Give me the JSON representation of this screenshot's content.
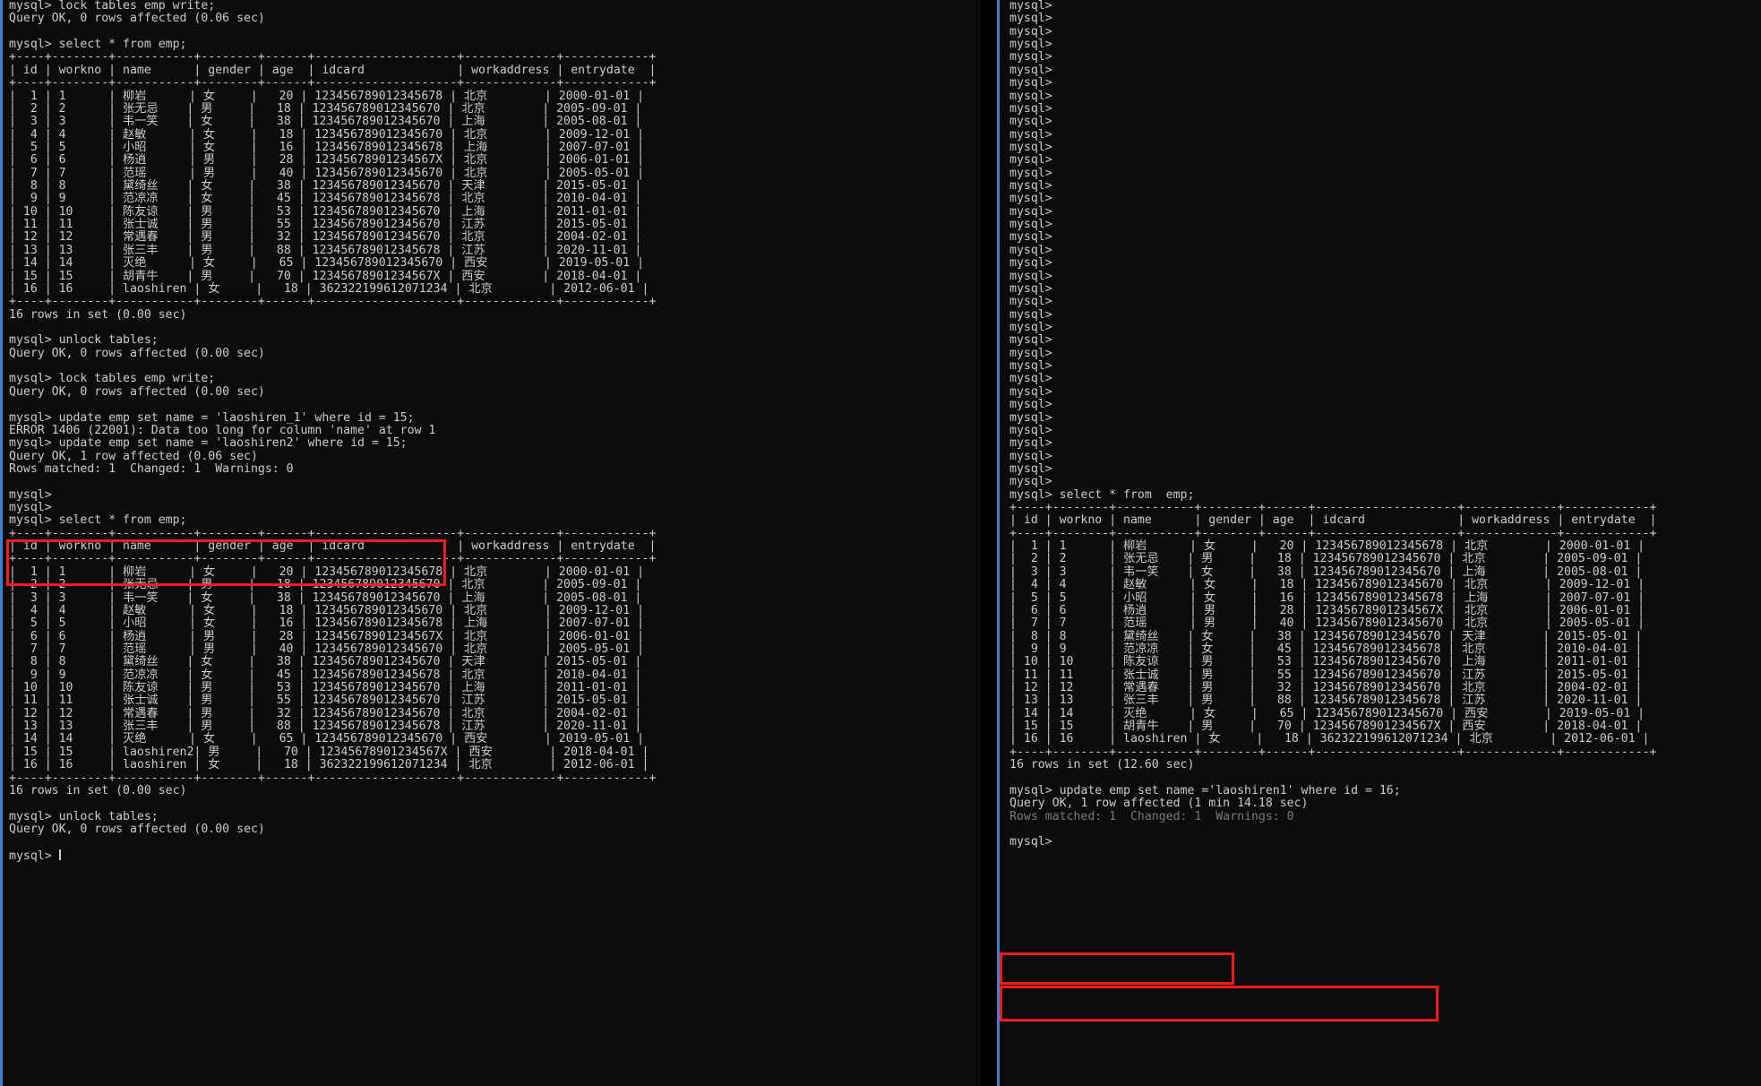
{
  "window": {
    "background": "#000000",
    "pane_background": "#0c0c0c",
    "text_color": "#cccccc",
    "accent_border": "#3f7fcf",
    "highlight_color": "#ff1a1a",
    "prompt": "mysql>"
  },
  "table_schema": {
    "columns": [
      "id",
      "workno",
      "name",
      "gender",
      "age",
      "idcard",
      "workaddress",
      "entrydate"
    ],
    "separator_left": "+----+--------+-----------+--------+------+--------------------+-------------+------------+",
    "header_left": "| id | workno | name      | gender | age  | idcard             | workaddress | entrydate  |",
    "separator_right": "+----+--------+-----------+--------+------+--------------------+-------------+------------+",
    "header_right": "| id | workno | name      | gender | age  | idcard             | workaddress | entrydate  |"
  },
  "left_pane": {
    "name": "left-terminal-pane",
    "lines": [
      {
        "id": "l0",
        "text": "mysql> lock tables emp write;"
      },
      {
        "id": "l1",
        "text": "Query OK, 0 rows affected (0.06 sec)"
      },
      {
        "id": "l2",
        "text": ""
      },
      {
        "id": "l3",
        "text": "mysql> select * from emp;"
      },
      {
        "id": "l4",
        "text": "+----+--------+-----------+--------+------+--------------------+-------------+------------+"
      },
      {
        "id": "l5",
        "text": "| id | workno | name      | gender | age  | idcard             | workaddress | entrydate  |"
      },
      {
        "id": "l6",
        "text": "+----+--------+-----------+--------+------+--------------------+-------------+------------+"
      },
      {
        "id": "l7",
        "text": "|  1 | 1      | 柳岩      | 女     |   20 | 123456789012345678 | 北京        | 2000-01-01 |"
      },
      {
        "id": "l8",
        "text": "|  2 | 2      | 张无忌    | 男     |   18 | 123456789012345670 | 北京        | 2005-09-01 |"
      },
      {
        "id": "l9",
        "text": "|  3 | 3      | 韦一笑    | 女     |   38 | 123456789012345670 | 上海        | 2005-08-01 |"
      },
      {
        "id": "l10",
        "text": "|  4 | 4      | 赵敏      | 女     |   18 | 123456789012345670 | 北京        | 2009-12-01 |"
      },
      {
        "id": "l11",
        "text": "|  5 | 5      | 小昭      | 女     |   16 | 123456789012345678 | 上海        | 2007-07-01 |"
      },
      {
        "id": "l12",
        "text": "|  6 | 6      | 杨逍      | 男     |   28 | 12345678901234567X | 北京        | 2006-01-01 |"
      },
      {
        "id": "l13",
        "text": "|  7 | 7      | 范瑶      | 男     |   40 | 123456789012345670 | 北京        | 2005-05-01 |"
      },
      {
        "id": "l14",
        "text": "|  8 | 8      | 黛绮丝    | 女     |   38 | 123456789012345670 | 天津        | 2015-05-01 |"
      },
      {
        "id": "l15",
        "text": "|  9 | 9      | 范凉凉    | 女     |   45 | 123456789012345678 | 北京        | 2010-04-01 |"
      },
      {
        "id": "l16",
        "text": "| 10 | 10     | 陈友谅    | 男     |   53 | 123456789012345670 | 上海        | 2011-01-01 |"
      },
      {
        "id": "l17",
        "text": "| 11 | 11     | 张士诚    | 男     |   55 | 123456789012345670 | 江苏        | 2015-05-01 |"
      },
      {
        "id": "l18",
        "text": "| 12 | 12     | 常遇春    | 男     |   32 | 123456789012345670 | 北京        | 2004-02-01 |"
      },
      {
        "id": "l19",
        "text": "| 13 | 13     | 张三丰    | 男     |   88 | 123456789012345678 | 江苏        | 2020-11-01 |"
      },
      {
        "id": "l20",
        "text": "| 14 | 14     | 灭绝      | 女     |   65 | 123456789012345670 | 西安        | 2019-05-01 |"
      },
      {
        "id": "l21",
        "text": "| 15 | 15     | 胡青牛    | 男     |   70 | 12345678901234567X | 西安        | 2018-04-01 |"
      },
      {
        "id": "l22",
        "text": "| 16 | 16     | laoshiren | 女     |   18 | 362322199612071234 | 北京        | 2012-06-01 |"
      },
      {
        "id": "l23",
        "text": "+----+--------+-----------+--------+------+--------------------+-------------+------------+"
      },
      {
        "id": "l24",
        "text": "16 rows in set (0.00 sec)"
      },
      {
        "id": "l25",
        "text": ""
      },
      {
        "id": "l26",
        "text": "mysql> unlock tables;"
      },
      {
        "id": "l27",
        "text": "Query OK, 0 rows affected (0.00 sec)"
      },
      {
        "id": "l28",
        "text": ""
      },
      {
        "id": "l29",
        "text": "mysql> lock tables emp write;"
      },
      {
        "id": "l30",
        "text": "Query OK, 0 rows affected (0.00 sec)"
      },
      {
        "id": "l31",
        "text": ""
      },
      {
        "id": "l32",
        "text": "mysql> update emp set name = 'laoshiren_1' where id = 15;"
      },
      {
        "id": "l33",
        "text": "ERROR 1406 (22001): Data too long for column 'name' at row 1"
      },
      {
        "id": "l34",
        "text": "mysql> update emp set name = 'laoshiren2' where id = 15;"
      },
      {
        "id": "l35",
        "text": "Query OK, 1 row affected (0.06 sec)"
      },
      {
        "id": "l36",
        "text": "Rows matched: 1  Changed: 1  Warnings: 0"
      },
      {
        "id": "l37",
        "text": ""
      },
      {
        "id": "l38",
        "text": "mysql>"
      },
      {
        "id": "l39",
        "text": "mysql>"
      },
      {
        "id": "l40",
        "text": "mysql> select * from emp;"
      },
      {
        "id": "l41",
        "text": "+----+--------+-----------+--------+------+--------------------+-------------+------------+"
      },
      {
        "id": "l42",
        "text": "| id | workno | name      | gender | age  | idcard             | workaddress | entrydate  |"
      },
      {
        "id": "l43",
        "text": "+----+--------+-----------+--------+------+--------------------+-------------+------------+"
      },
      {
        "id": "l44",
        "text": "|  1 | 1      | 柳岩      | 女     |   20 | 123456789012345678 | 北京        | 2000-01-01 |"
      },
      {
        "id": "l45",
        "text": "|  2 | 2      | 张无忌    | 男     |   18 | 123456789012345670 | 北京        | 2005-09-01 |"
      },
      {
        "id": "l46",
        "text": "|  3 | 3      | 韦一笑    | 女     |   38 | 123456789012345670 | 上海        | 2005-08-01 |"
      },
      {
        "id": "l47",
        "text": "|  4 | 4      | 赵敏      | 女     |   18 | 123456789012345670 | 北京        | 2009-12-01 |"
      },
      {
        "id": "l48",
        "text": "|  5 | 5      | 小昭      | 女     |   16 | 123456789012345678 | 上海        | 2007-07-01 |"
      },
      {
        "id": "l49",
        "text": "|  6 | 6      | 杨逍      | 男     |   28 | 12345678901234567X | 北京        | 2006-01-01 |"
      },
      {
        "id": "l50",
        "text": "|  7 | 7      | 范瑶      | 男     |   40 | 123456789012345670 | 北京        | 2005-05-01 |"
      },
      {
        "id": "l51",
        "text": "|  8 | 8      | 黛绮丝    | 女     |   38 | 123456789012345670 | 天津        | 2015-05-01 |"
      },
      {
        "id": "l52",
        "text": "|  9 | 9      | 范凉凉    | 女     |   45 | 123456789012345678 | 北京        | 2010-04-01 |"
      },
      {
        "id": "l53",
        "text": "| 10 | 10     | 陈友谅    | 男     |   53 | 123456789012345670 | 上海        | 2011-01-01 |"
      },
      {
        "id": "l54",
        "text": "| 11 | 11     | 张士诚    | 男     |   55 | 123456789012345670 | 江苏        | 2015-05-01 |"
      },
      {
        "id": "l55",
        "text": "| 12 | 12     | 常遇春    | 男     |   32 | 123456789012345670 | 北京        | 2004-02-01 |"
      },
      {
        "id": "l56",
        "text": "| 13 | 13     | 张三丰    | 男     |   88 | 123456789012345678 | 江苏        | 2020-11-01 |"
      },
      {
        "id": "l57",
        "text": "| 14 | 14     | 灭绝      | 女     |   65 | 123456789012345670 | 西安        | 2019-05-01 |"
      },
      {
        "id": "l58",
        "text": "| 15 | 15     | laoshiren2| 男     |   70 | 12345678901234567X | 西安        | 2018-04-01 |"
      },
      {
        "id": "l59",
        "text": "| 16 | 16     | laoshiren | 女     |   18 | 362322199612071234 | 北京        | 2012-06-01 |"
      },
      {
        "id": "l60",
        "text": "+----+--------+-----------+--------+------+--------------------+-------------+------------+"
      },
      {
        "id": "l61",
        "text": "16 rows in set (0.00 sec)"
      },
      {
        "id": "l62",
        "text": ""
      },
      {
        "id": "l63",
        "text": "mysql> unlock tables;"
      },
      {
        "id": "l64",
        "text": "Query OK, 0 rows affected (0.00 sec)"
      },
      {
        "id": "l65",
        "text": ""
      },
      {
        "id": "l66",
        "text": "mysql> ",
        "cursor": true
      }
    ],
    "highlight_box": {
      "name": "left-update-highlight",
      "lines": [
        "mysql> update emp set name = 'laoshiren2' where id = 15;",
        "Query OK, 1 row affected (0.06 sec)",
        "Rows matched: 1  Changed: 1  Warnings: 0"
      ]
    }
  },
  "right_pane": {
    "name": "right-terminal-pane",
    "idle_prompt_count": 38,
    "lines": [
      {
        "id": "r0",
        "text": "mysql> select * from  emp;"
      },
      {
        "id": "r1",
        "text": "+----+--------+-----------+--------+------+--------------------+-------------+------------+"
      },
      {
        "id": "r2",
        "text": "| id | workno | name      | gender | age  | idcard             | workaddress | entrydate  |"
      },
      {
        "id": "r3",
        "text": "+----+--------+-----------+--------+------+--------------------+-------------+------------+"
      },
      {
        "id": "r4",
        "text": "|  1 | 1      | 柳岩      | 女     |   20 | 123456789012345678 | 北京        | 2000-01-01 |"
      },
      {
        "id": "r5",
        "text": "|  2 | 2      | 张无忌    | 男     |   18 | 123456789012345670 | 北京        | 2005-09-01 |"
      },
      {
        "id": "r6",
        "text": "|  3 | 3      | 韦一笑    | 女     |   38 | 123456789012345670 | 上海        | 2005-08-01 |"
      },
      {
        "id": "r7",
        "text": "|  4 | 4      | 赵敏      | 女     |   18 | 123456789012345670 | 北京        | 2009-12-01 |"
      },
      {
        "id": "r8",
        "text": "|  5 | 5      | 小昭      | 女     |   16 | 123456789012345678 | 上海        | 2007-07-01 |"
      },
      {
        "id": "r9",
        "text": "|  6 | 6      | 杨逍      | 男     |   28 | 12345678901234567X | 北京        | 2006-01-01 |"
      },
      {
        "id": "r10",
        "text": "|  7 | 7      | 范瑶      | 男     |   40 | 123456789012345670 | 北京        | 2005-05-01 |"
      },
      {
        "id": "r11",
        "text": "|  8 | 8      | 黛绮丝    | 女     |   38 | 123456789012345670 | 天津        | 2015-05-01 |"
      },
      {
        "id": "r12",
        "text": "|  9 | 9      | 范凉凉    | 女     |   45 | 123456789012345678 | 北京        | 2010-04-01 |"
      },
      {
        "id": "r13",
        "text": "| 10 | 10     | 陈友谅    | 男     |   53 | 123456789012345670 | 上海        | 2011-01-01 |"
      },
      {
        "id": "r14",
        "text": "| 11 | 11     | 张士诚    | 男     |   55 | 123456789012345670 | 江苏        | 2015-05-01 |"
      },
      {
        "id": "r15",
        "text": "| 12 | 12     | 常遇春    | 男     |   32 | 123456789012345670 | 北京        | 2004-02-01 |"
      },
      {
        "id": "r16",
        "text": "| 13 | 13     | 张三丰    | 男     |   88 | 123456789012345678 | 江苏        | 2020-11-01 |"
      },
      {
        "id": "r17",
        "text": "| 14 | 14     | 灭绝      | 女     |   65 | 123456789012345670 | 西安        | 2019-05-01 |"
      },
      {
        "id": "r18",
        "text": "| 15 | 15     | 胡青牛    | 男     |   70 | 12345678901234567X | 西安        | 2018-04-01 |"
      },
      {
        "id": "r19",
        "text": "| 16 | 16     | laoshiren | 女     |   18 | 362322199612071234 | 北京        | 2012-06-01 |"
      },
      {
        "id": "r20",
        "text": "+----+--------+-----------+--------+------+--------------------+-------------+------------+"
      },
      {
        "id": "r21",
        "text": "16 rows in set (12.60 sec)"
      },
      {
        "id": "r22",
        "text": ""
      },
      {
        "id": "r23",
        "text": "mysql> update emp set name ='laoshiren1' where id = 16;"
      },
      {
        "id": "r24",
        "text": "Query OK, 1 row affected (1 min 14.18 sec)"
      },
      {
        "id": "r25",
        "text": "Rows matched: 1  Changed: 1  Warnings: 0",
        "dim": true
      },
      {
        "id": "r26",
        "text": ""
      },
      {
        "id": "r27",
        "text": "mysql>"
      }
    ],
    "highlight_rows_box": {
      "name": "right-rows-in-set-highlight",
      "text": "16 rows in set (12.60 sec)"
    },
    "highlight_update_box": {
      "name": "right-update-highlight",
      "lines": [
        "mysql> update emp set name ='laoshiren1' where id = 16;",
        "Query OK, 1 row affected (1 min 14.18 sec)"
      ]
    }
  }
}
